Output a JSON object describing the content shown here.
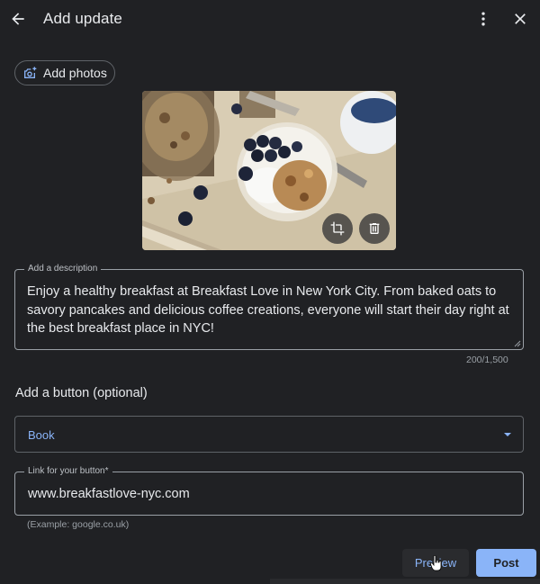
{
  "header": {
    "title": "Add update",
    "back_icon": "arrow-back-icon",
    "more_icon": "more-vert-icon",
    "close_icon": "close-icon"
  },
  "photos": {
    "add_label": "Add photos",
    "add_icon": "add-photo-icon",
    "crop_icon": "crop-icon",
    "delete_icon": "trash-icon"
  },
  "description": {
    "label": "Add a description",
    "value": "Enjoy a healthy breakfast at Breakfast Love in New York City. From baked oats to savory pancakes and delicious coffee creations, everyone will start their day right at the best breakfast place in NYC!",
    "counter": "200/1,500"
  },
  "button_section": {
    "heading": "Add a button (optional)",
    "selected": "Book"
  },
  "link": {
    "label": "Link for your button*",
    "value": "www.breakfastlove-nyc.com",
    "hint": "(Example: google.co.uk)"
  },
  "actions": {
    "preview_label": "Preview",
    "post_label": "Post"
  },
  "colors": {
    "background": "#202124",
    "accent": "#8ab4f8",
    "text": "#e8eaed",
    "muted": "#9aa0a6"
  }
}
